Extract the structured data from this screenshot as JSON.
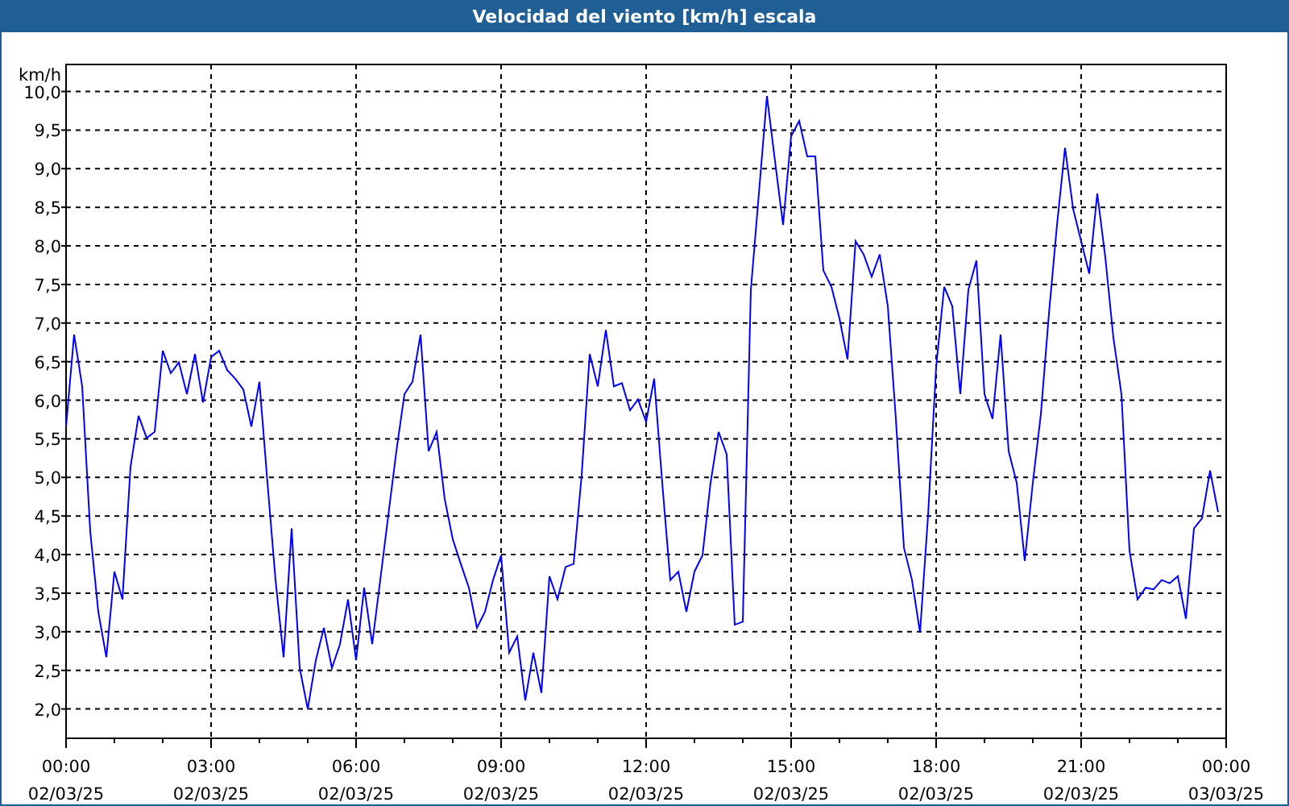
{
  "window": {
    "title": "Velocidad del viento [km/h] escala"
  },
  "chart": {
    "x_dates": [
      "02/03/25",
      "02/03/25",
      "02/03/25",
      "02/03/25",
      "02/03/25",
      "02/03/25",
      "02/03/25",
      "02/03/25",
      "03/03/25"
    ],
    "chart_data": {
      "type": "line",
      "grid": true,
      "ylabel": "km/h",
      "ylim": [
        1.62,
        10.35
      ],
      "yticks": [
        {
          "value": 2,
          "label": "2,0"
        },
        {
          "value": 2.5,
          "label": "2,5"
        },
        {
          "value": 3,
          "label": "3,0"
        },
        {
          "value": 3.5,
          "label": "3,5"
        },
        {
          "value": 4,
          "label": "4,0"
        },
        {
          "value": 4.5,
          "label": "4,5"
        },
        {
          "value": 5,
          "label": "5,0"
        },
        {
          "value": 5.5,
          "label": "5,5"
        },
        {
          "value": 6,
          "label": "6,0"
        },
        {
          "value": 6.5,
          "label": "6,5"
        },
        {
          "value": 7,
          "label": "7,0"
        },
        {
          "value": 7.5,
          "label": "7,5"
        },
        {
          "value": 8,
          "label": "8,0"
        },
        {
          "value": 8.5,
          "label": "8,5"
        },
        {
          "value": 9,
          "label": "9,0"
        },
        {
          "value": 9.5,
          "label": "9,5"
        },
        {
          "value": 10,
          "label": "10,0"
        }
      ],
      "categories": [
        "00:00",
        null,
        null,
        null,
        null,
        null,
        null,
        null,
        null,
        null,
        null,
        null,
        null,
        null,
        null,
        null,
        null,
        null,
        "03:00",
        null,
        null,
        null,
        null,
        null,
        null,
        null,
        null,
        null,
        null,
        null,
        null,
        null,
        null,
        null,
        null,
        null,
        "06:00",
        null,
        null,
        null,
        null,
        null,
        null,
        null,
        null,
        null,
        null,
        null,
        null,
        null,
        null,
        null,
        null,
        null,
        "09:00",
        null,
        null,
        null,
        null,
        null,
        null,
        null,
        null,
        null,
        null,
        null,
        null,
        null,
        null,
        null,
        null,
        null,
        "12:00",
        null,
        null,
        null,
        null,
        null,
        null,
        null,
        null,
        null,
        null,
        null,
        null,
        null,
        null,
        null,
        null,
        null,
        "15:00",
        null,
        null,
        null,
        null,
        null,
        null,
        null,
        null,
        null,
        null,
        null,
        null,
        null,
        null,
        null,
        null,
        null,
        "18:00",
        null,
        null,
        null,
        null,
        null,
        null,
        null,
        null,
        null,
        null,
        null,
        null,
        null,
        null,
        null,
        null,
        null,
        "21:00",
        null,
        null,
        null,
        null,
        null,
        null,
        null,
        null,
        null,
        null,
        null,
        null,
        null,
        null,
        null,
        null,
        null,
        "00:00"
      ],
      "series": [
        {
          "color": "#0000ff",
          "values": [
            5.66,
            6.85,
            6.18,
            4.3,
            3.26,
            2.67,
            3.78,
            3.42,
            5.14,
            5.8,
            5.51,
            5.59,
            6.64,
            6.35,
            6.49,
            6.08,
            6.6,
            5.97,
            6.56,
            6.64,
            6.39,
            6.28,
            6.14,
            5.66,
            6.24,
            4.93,
            3.67,
            2.67,
            4.34,
            2.53,
            2.0,
            2.63,
            3.05,
            2.53,
            2.84,
            3.42,
            2.63,
            3.57,
            2.84,
            3.67,
            4.51,
            5.34,
            6.08,
            6.24,
            6.85,
            5.34,
            5.59,
            4.72,
            4.2,
            3.88,
            3.57,
            3.05,
            3.26,
            3.67,
            3.99,
            2.73,
            2.94,
            2.11,
            2.73,
            2.21,
            3.72,
            3.42,
            3.84,
            3.88,
            5.03,
            6.6,
            6.18,
            6.91,
            6.18,
            6.22,
            5.87,
            6.01,
            5.72,
            6.28,
            4.93,
            3.67,
            3.78,
            3.26,
            3.78,
            3.99,
            4.93,
            5.59,
            5.3,
            3.09,
            3.13,
            7.43,
            8.68,
            9.94,
            9.1,
            8.27,
            9.42,
            9.62,
            9.16,
            9.16,
            7.68,
            7.47,
            7.06,
            6.53,
            8.06,
            7.89,
            7.6,
            7.89,
            7.22,
            5.76,
            4.09,
            3.67,
            2.99,
            4.51,
            6.43,
            7.47,
            7.22,
            6.08,
            7.43,
            7.81,
            6.08,
            5.76,
            6.85,
            5.34,
            4.93,
            3.92,
            4.93,
            5.82,
            7.12,
            8.27,
            9.27,
            8.48,
            8.06,
            7.64,
            8.68,
            7.85,
            6.81,
            6.08,
            4.05,
            3.42,
            3.57,
            3.55,
            3.67,
            3.63,
            3.72,
            3.17,
            4.34,
            4.47,
            5.09,
            4.55,
            null
          ]
        }
      ]
    }
  }
}
